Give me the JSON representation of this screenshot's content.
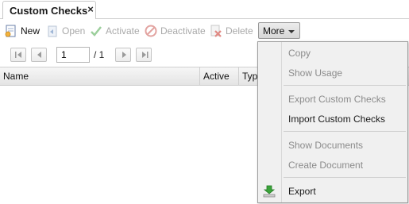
{
  "tabs": [
    {
      "label": "Custom Checks",
      "close": "×"
    }
  ],
  "toolbar": {
    "new_label": "New",
    "open_label": "Open",
    "activate_label": "Activate",
    "deactivate_label": "Deactivate",
    "delete_label": "Delete",
    "more_label": "More"
  },
  "pager": {
    "current_page": "1",
    "of_label": "/ 1"
  },
  "grid": {
    "columns": [
      "Name",
      "Active",
      "Typ"
    ],
    "rows": []
  },
  "menu": {
    "items": [
      {
        "label": "Copy",
        "enabled": false
      },
      {
        "label": "Show Usage",
        "enabled": false
      },
      {
        "label": "Export Custom Checks",
        "enabled": false
      },
      {
        "label": "Import Custom Checks",
        "enabled": true
      },
      {
        "label": "Show Documents",
        "enabled": false
      },
      {
        "label": "Create Document",
        "enabled": false
      },
      {
        "label": "Export",
        "enabled": true,
        "icon": "download-icon"
      }
    ]
  },
  "colors": {
    "accent_green": "#3aa33a",
    "delete_red": "#d63b2f",
    "disabled_text": "#a9a9a9"
  }
}
